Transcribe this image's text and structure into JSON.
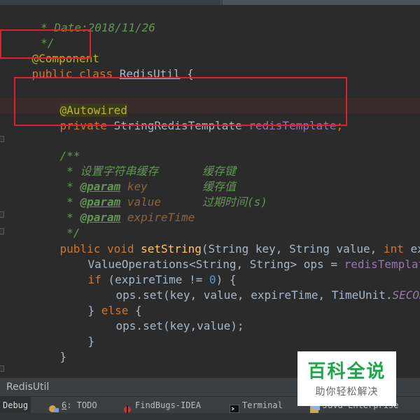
{
  "editor": {
    "lines": {
      "date": " * Date:2018/11/26",
      "close_comment": " */",
      "component": "@Component",
      "class_public": "public",
      "class_kw": "class",
      "class_name": "RedisUtil",
      "class_brace": " {",
      "autowired": "@Autowired",
      "field_private": "private",
      "field_type": " StringRedisTemplate ",
      "field_name": "redisTemplate",
      "field_semi": ";",
      "doc_open": "/**",
      "doc_desc": " * 设置字符串缓存",
      "param_star": " * ",
      "param_tag": "@param",
      "p1_name": "key",
      "p1_desc": "缓存键",
      "p2_name": "value",
      "p2_desc": "缓存值",
      "p3_name": "expireTime",
      "p3_desc": "过期时间(s)",
      "doc_close": " */",
      "m_public": "public",
      "m_void": "void",
      "m_name": "setString",
      "m_params_a": "(String key, String value, ",
      "m_int": "int",
      "m_params_b": " expi",
      "ops_type": "ValueOperations<String, String> ops = ",
      "ops_field": "redisTemplate",
      "if_kw": "if",
      "if_cond_a": " (expireTime != ",
      "if_zero": "0",
      "if_cond_b": ") {",
      "set1_a": "ops.set(key, value, expireTime, TimeUnit.",
      "set1_const": "SECONDS",
      "else_a": "} ",
      "else_kw": "else",
      "else_b": " {",
      "set2": "ops.set(key,value);",
      "close_inner": "}",
      "close_method": "}",
      "doc2_open": "/**"
    }
  },
  "status": {
    "breadcrumb": "RedisUtil"
  },
  "toolbar": {
    "debug": "Debug",
    "todo_num": "6",
    "todo_label": ": TODO",
    "findbugs": "FindBugs-IDEA",
    "terminal": "Terminal",
    "java_enterprise": "Java Enterprise"
  },
  "watermark": {
    "title": "百科全说",
    "subtitle": "助你轻松解决"
  },
  "colors": {
    "background": "#2b2b2b",
    "highlight_box": "#e0202a",
    "annotation": "#bbb529",
    "keyword": "#cc7832",
    "comment": "#629755"
  }
}
